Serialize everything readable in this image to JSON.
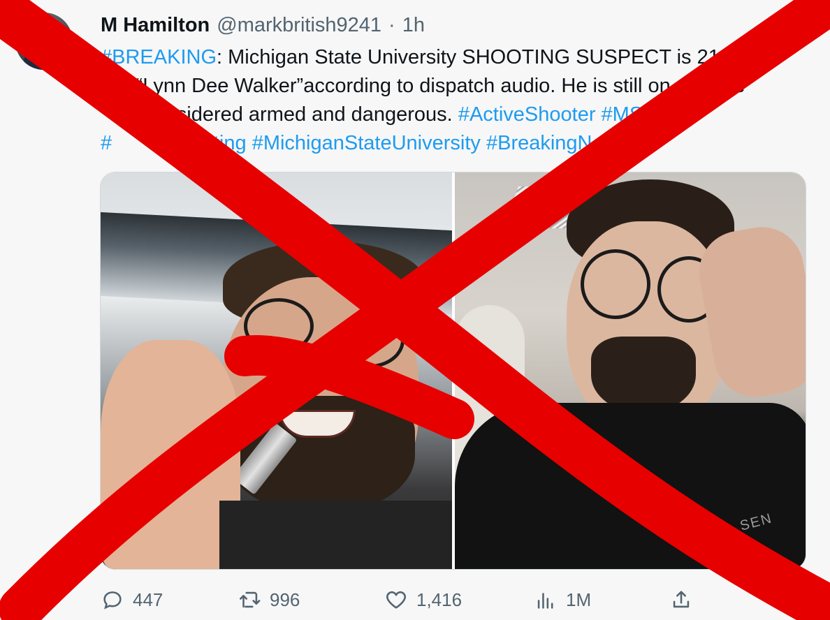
{
  "author": {
    "name": "M Hamilton",
    "handle": "@markbritish9241",
    "separator": "·",
    "time": "1h"
  },
  "tweet": {
    "line1": [
      {
        "text": "#BREAKING",
        "tag": true
      },
      {
        "text": ": Michigan State University SHOOTING SUSPECT is 21 y",
        "tag": false
      }
    ],
    "line2": [
      {
        "text": "ld “Lynn Dee Walker”according to dispatch audio. He is still on",
        "tag": false
      },
      {
        "text": " ",
        "tag": false
      },
      {
        "text": "ose",
        "tag": false
      }
    ],
    "line3": [
      {
        "text": "considered armed and dangerous. ",
        "tag": false
      },
      {
        "text": "#ActiveShooter",
        "tag": true
      },
      {
        "text": " ",
        "tag": false
      },
      {
        "text": "#MS",
        "tag": true
      }
    ],
    "line4": [
      {
        "text": "#",
        "tag": true
      },
      {
        "text": "Shooting",
        "tag": true
      },
      {
        "text": " ",
        "tag": false
      },
      {
        "text": "#MichiganStateUniversity",
        "tag": true
      },
      {
        "text": " ",
        "tag": false
      },
      {
        "text": "#BreakingNe",
        "tag": true
      }
    ]
  },
  "media": {
    "photo_right_print": "SEN"
  },
  "actions": {
    "replies": "447",
    "retweets": "996",
    "likes": "1,416",
    "views": "1M"
  },
  "colors": {
    "link": "#1d9bf0",
    "muted": "#536471",
    "overlay_cross": "#e60000"
  },
  "icons": {
    "reply": "reply-icon",
    "retweet": "retweet-icon",
    "like": "heart-icon",
    "views": "views-icon",
    "share": "share-icon"
  }
}
